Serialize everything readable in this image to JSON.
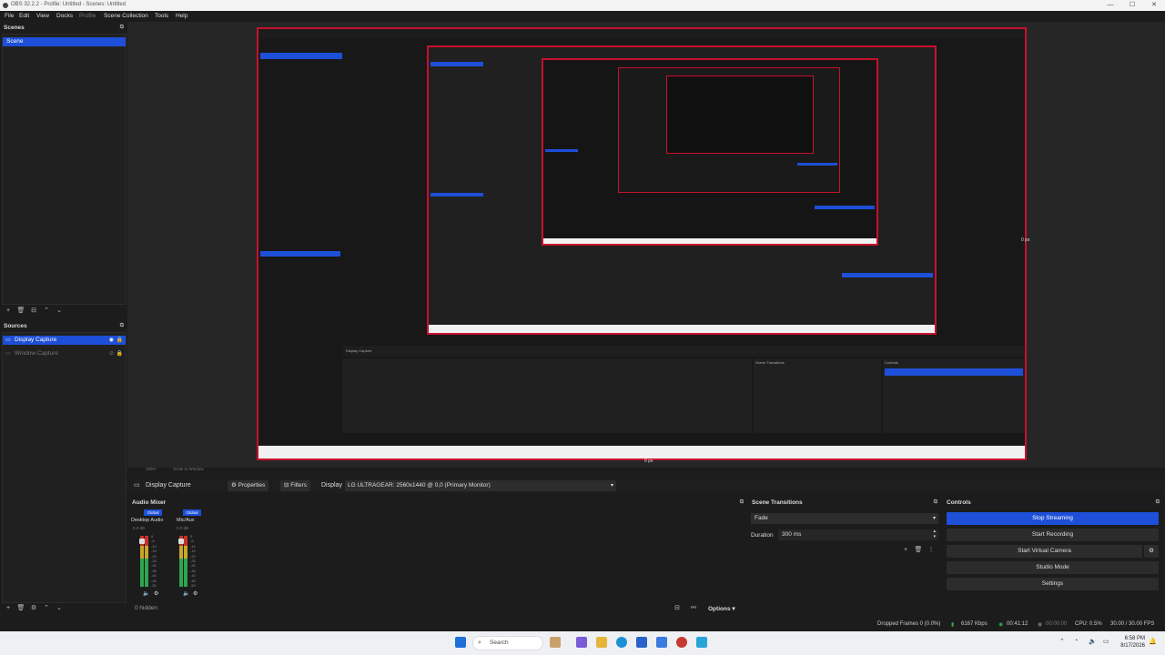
{
  "window": {
    "title": "OBS 32.2.2 - Profile: Untitled - Scenes: Untitled",
    "controls": [
      "—",
      "☐",
      "✕"
    ]
  },
  "menu": [
    "File",
    "Edit",
    "View",
    "Docks",
    "Profile",
    "Scene Collection",
    "Tools",
    "Help"
  ],
  "scenes": {
    "header": "Scenes",
    "items": [
      "Scene"
    ]
  },
  "sources": {
    "header": "Sources",
    "items": [
      {
        "label": "Display Capture",
        "selected": true
      },
      {
        "label": "Window Capture",
        "selected": false
      }
    ]
  },
  "preview": {
    "bottom_left": "100%",
    "bottom_scale": "Scale to Window",
    "right_label": "0 px",
    "bottom_label": "0 px"
  },
  "context": {
    "source_name": "Display Capture",
    "properties": "Properties",
    "filters": "Filters",
    "display_label": "Display",
    "display_value": "LG ULTRAGEAR: 2560x1440 @ 0,0 (Primary Monitor)"
  },
  "mixer": {
    "header": "Audio Mixer",
    "channels": [
      {
        "tag": "Global",
        "name": "Desktop Audio",
        "db": "0.0 dB"
      },
      {
        "tag": "Global",
        "name": "Mic/Aux",
        "db": "0.0 dB"
      }
    ],
    "scale": [
      "0",
      "-5",
      "-10",
      "-15",
      "-20",
      "-25",
      "-30",
      "-35",
      "-40",
      "-45",
      "-50",
      "-55",
      "-60"
    ],
    "hidden": "0 hidden",
    "options": "Options"
  },
  "transitions": {
    "header": "Scene Transitions",
    "type": "Fade",
    "duration_label": "Duration",
    "duration": "300 ms"
  },
  "controls": {
    "header": "Controls",
    "stop_streaming": "Stop Streaming",
    "start_recording": "Start Recording",
    "start_virtual_camera": "Start Virtual Camera",
    "studio_mode": "Studio Mode",
    "settings": "Settings"
  },
  "status": {
    "dropped": "Dropped Frames 0 (0.0%)",
    "kbps": "6167 Kbps",
    "stream_time": "00:41:12",
    "rec_time": "00:00:00",
    "cpu": "CPU: 0.5%",
    "fps": "30.00 / 30.00 FPS"
  },
  "taskbar": {
    "search": "Search",
    "time": "6:58 PM",
    "date": "8/17/2026"
  },
  "colors": {
    "accent": "#1e4fd8",
    "border_red": "#c8102e"
  }
}
